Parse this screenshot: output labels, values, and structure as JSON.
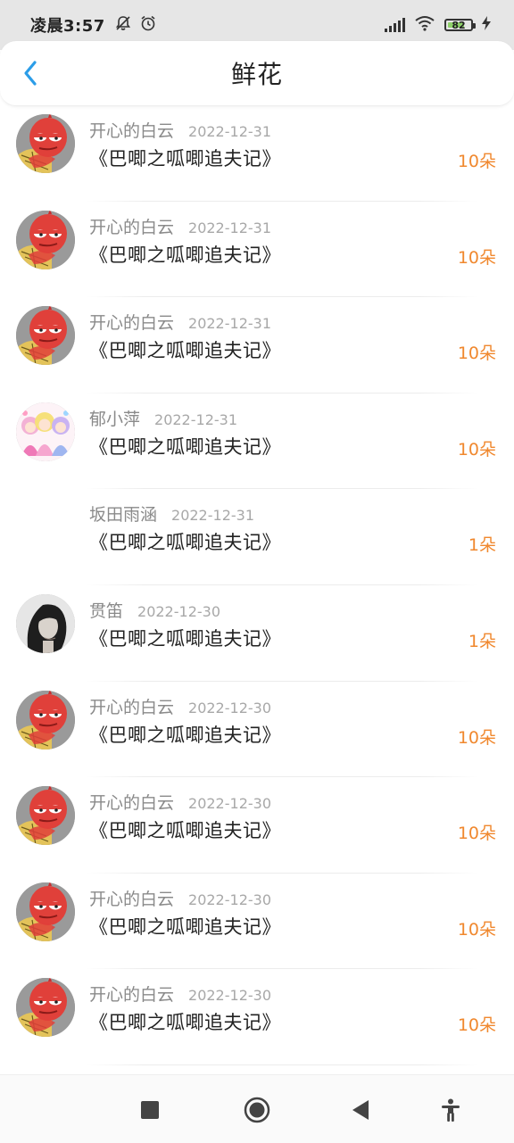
{
  "status_bar": {
    "time": "凌晨3:57",
    "battery": "82"
  },
  "header": {
    "title": "鲜花"
  },
  "list": [
    {
      "name": "开心的白云",
      "date": "2022-12-31",
      "book": "《巴唧之呱唧追夫记》",
      "count": "10朵",
      "avatar": "red-monster"
    },
    {
      "name": "开心的白云",
      "date": "2022-12-31",
      "book": "《巴唧之呱唧追夫记》",
      "count": "10朵",
      "avatar": "red-monster"
    },
    {
      "name": "开心的白云",
      "date": "2022-12-31",
      "book": "《巴唧之呱唧追夫记》",
      "count": "10朵",
      "avatar": "red-monster"
    },
    {
      "name": "郁小萍",
      "date": "2022-12-31",
      "book": "《巴唧之呱唧追夫记》",
      "count": "10朵",
      "avatar": "anime-girls"
    },
    {
      "name": "坂田雨涵",
      "date": "2022-12-31",
      "book": "《巴唧之呱唧追夫记》",
      "count": "1朵",
      "avatar": "none"
    },
    {
      "name": "贯笛",
      "date": "2022-12-30",
      "book": "《巴唧之呱唧追夫记》",
      "count": "1朵",
      "avatar": "portrait"
    },
    {
      "name": "开心的白云",
      "date": "2022-12-30",
      "book": "《巴唧之呱唧追夫记》",
      "count": "10朵",
      "avatar": "red-monster"
    },
    {
      "name": "开心的白云",
      "date": "2022-12-30",
      "book": "《巴唧之呱唧追夫记》",
      "count": "10朵",
      "avatar": "red-monster"
    },
    {
      "name": "开心的白云",
      "date": "2022-12-30",
      "book": "《巴唧之呱唧追夫记》",
      "count": "10朵",
      "avatar": "red-monster"
    },
    {
      "name": "开心的白云",
      "date": "2022-12-30",
      "book": "《巴唧之呱唧追夫记》",
      "count": "10朵",
      "avatar": "red-monster"
    }
  ],
  "colors": {
    "accent": "#2b9de8",
    "count": "#f0882e",
    "name": "#8a8a8a",
    "date": "#a8a8a8"
  },
  "nav": {
    "buttons": [
      "recents-square-icon",
      "home-circle-icon",
      "back-triangle-icon",
      "accessibility-icon"
    ]
  }
}
